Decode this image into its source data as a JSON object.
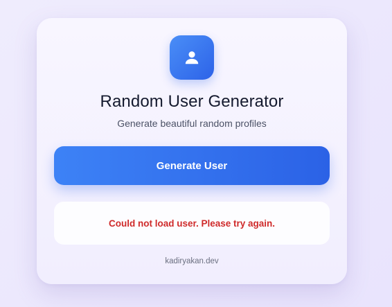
{
  "header": {
    "icon": "user-icon",
    "title": "Random User Generator",
    "subtitle": "Generate beautiful random profiles"
  },
  "actions": {
    "generate_label": "Generate User"
  },
  "status": {
    "error_message": "Could not load user. Please try again."
  },
  "footer": {
    "credit": "kadiryakan.dev"
  },
  "colors": {
    "accent": "#2d63e8",
    "error": "#cf2a2a",
    "background": "#ece8fd"
  }
}
